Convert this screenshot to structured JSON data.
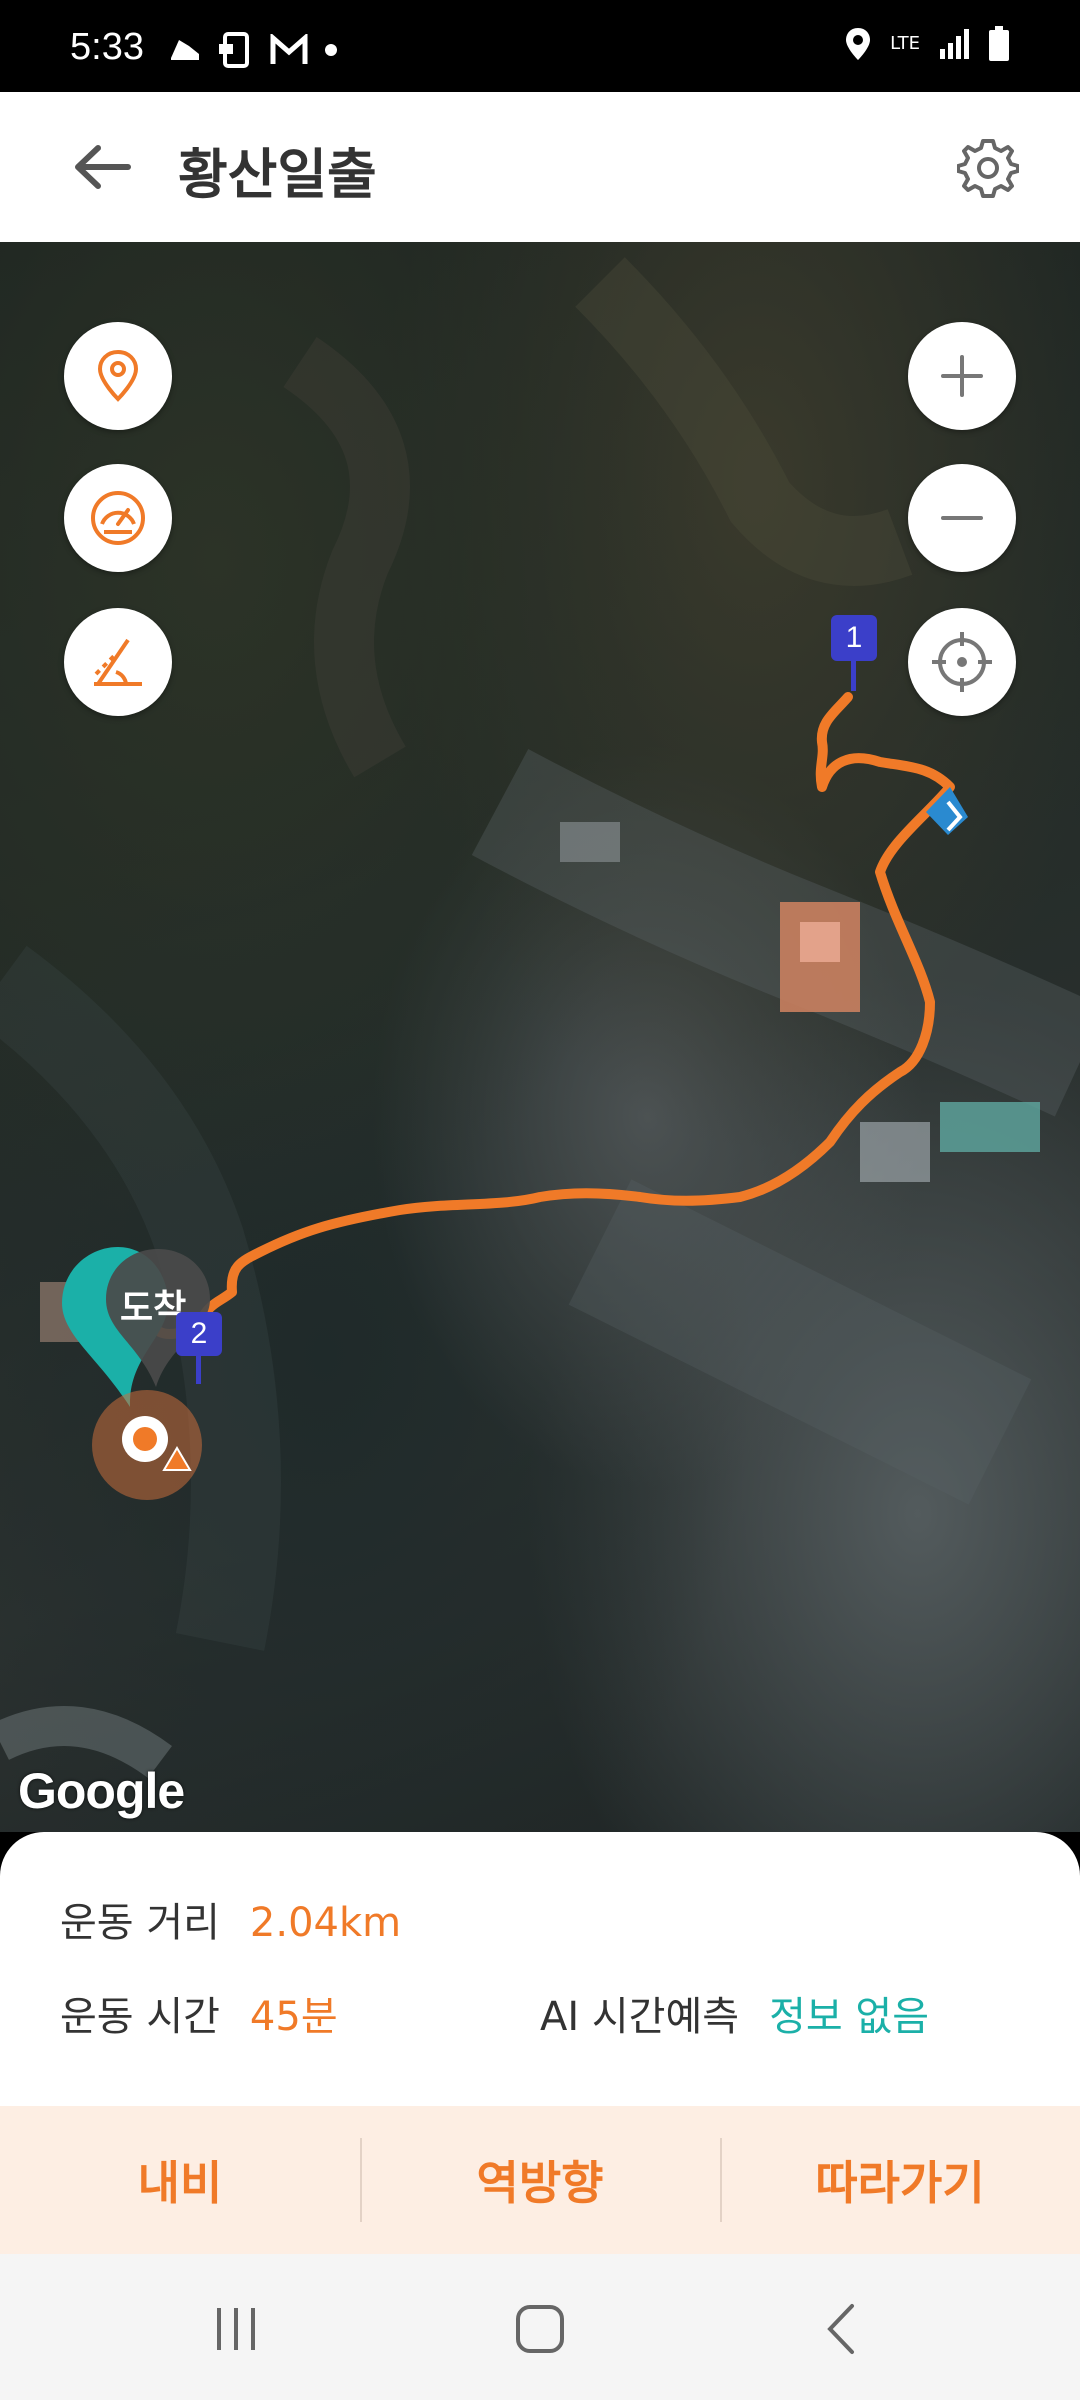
{
  "status_bar": {
    "time": "5:33",
    "network": "LTE",
    "icons": [
      "shoe-icon",
      "phone-screen-icon",
      "gmail-icon",
      "dot-icon",
      "location-icon",
      "signal-icon",
      "battery-icon"
    ]
  },
  "header": {
    "title": "황산일출",
    "back_icon": "arrow-left-icon",
    "settings_icon": "gear-icon"
  },
  "map": {
    "left_controls": [
      "location-pin-icon",
      "speedometer-icon",
      "elevation-icon"
    ],
    "right_controls": [
      "zoom-in-icon",
      "zoom-out-icon",
      "crosshair-icon"
    ],
    "markers": {
      "start_number": "1",
      "end_number": "2",
      "arrival_label": "도착"
    },
    "attribution": "Google",
    "route_color": "#f07a28"
  },
  "info": {
    "distance_label": "운동 거리",
    "distance_value": "2.04km",
    "time_label": "운동 시간",
    "time_value": "45분",
    "ai_label": "AI 시간예측",
    "ai_value": "정보 없음"
  },
  "actions": {
    "navi": "내비",
    "reverse": "역방향",
    "follow": "따라가기"
  },
  "nav_bar": [
    "recents-icon",
    "home-icon",
    "back-icon"
  ],
  "colors": {
    "accent": "#f07a28",
    "teal": "#1bb0a8",
    "marker_blue": "#3b3fc9",
    "action_bg": "#fdeee3"
  }
}
